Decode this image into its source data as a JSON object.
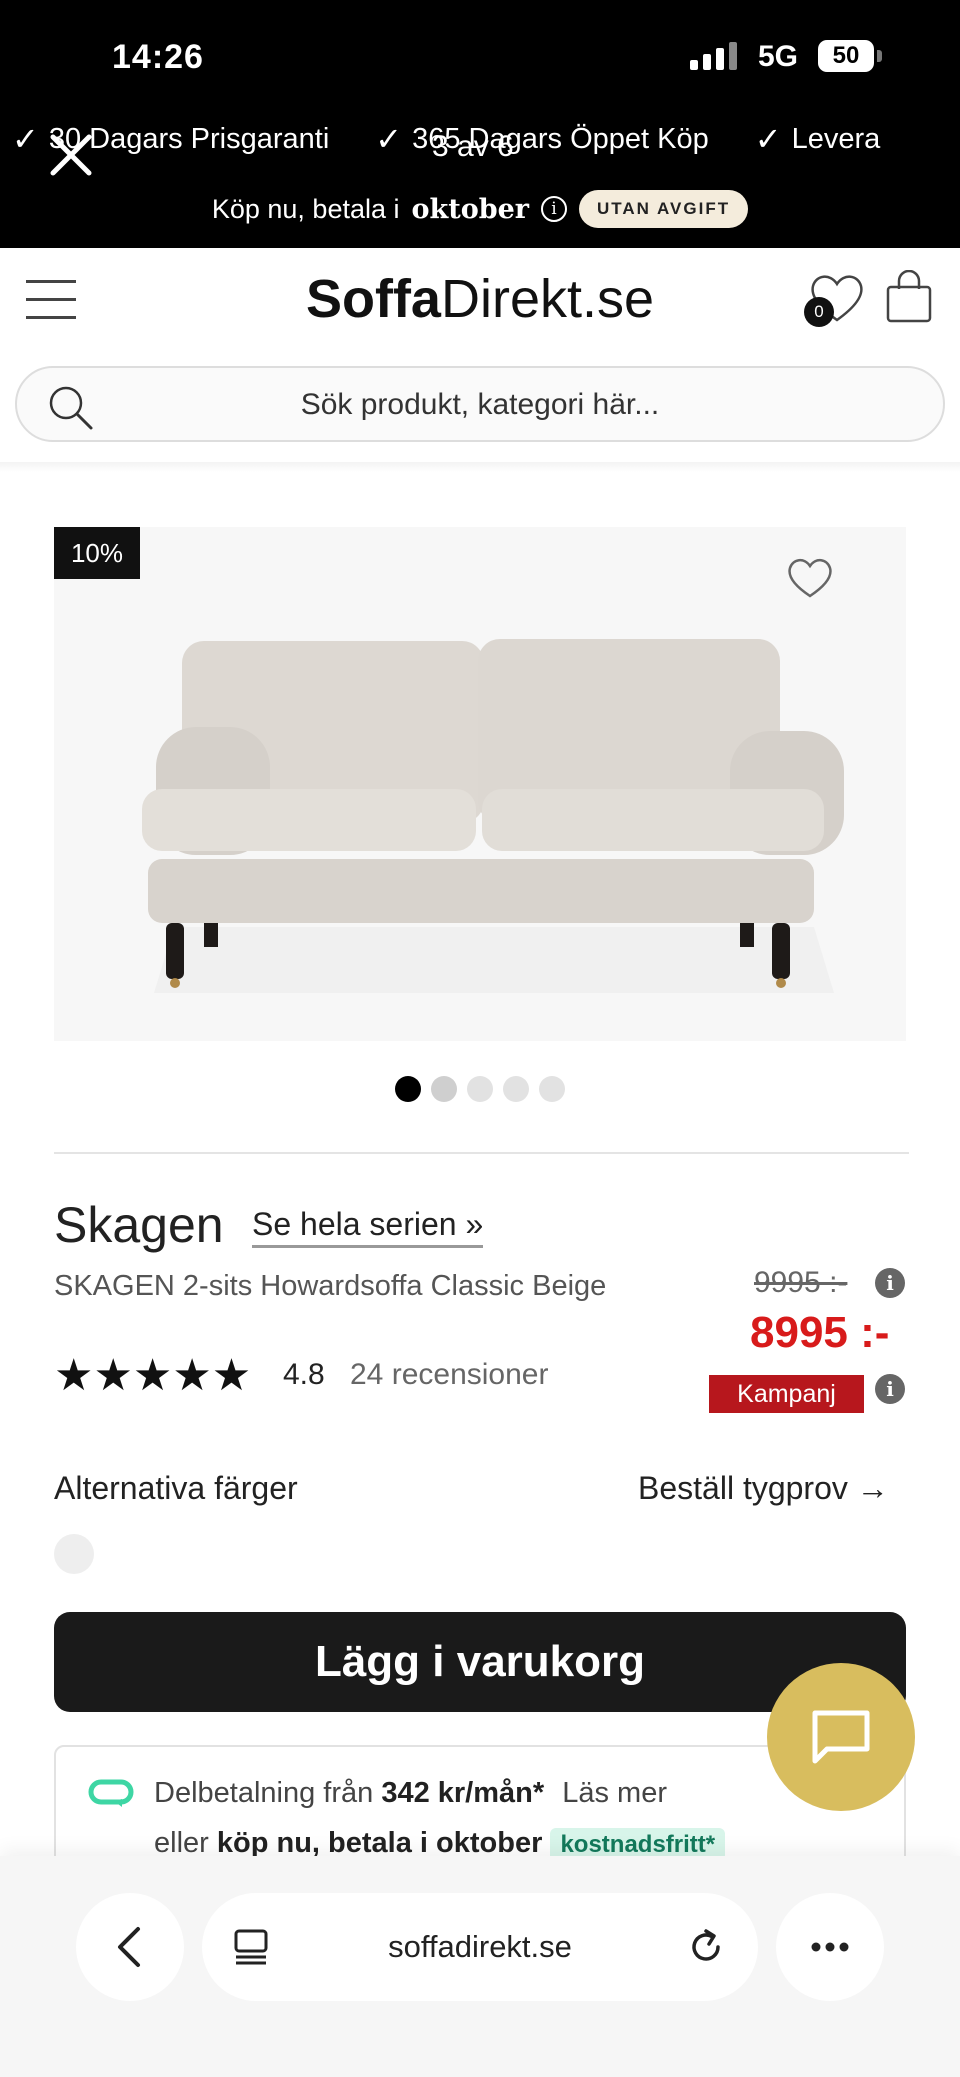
{
  "status": {
    "time": "14:26",
    "network": "5G",
    "battery": "50"
  },
  "banner": {
    "usps": [
      "30 Dagars Prisgaranti",
      "365 Dagars Öppet Köp",
      "Levera"
    ],
    "gallery_counter": "3 av 6",
    "paylater_text": "Köp nu, betala i",
    "paylater_brand": "oktober",
    "paylater_badge": "UTAN AVGIFT"
  },
  "header": {
    "logo_bold": "Soffa",
    "logo_rest": "Direkt.se",
    "wishlist_count": "0"
  },
  "search": {
    "placeholder": "Sök produkt, kategori här..."
  },
  "product": {
    "discount_badge": "10%",
    "gallery_dots": 5,
    "gallery_active": 0,
    "series": "Skagen",
    "series_link": "Se hela serien »",
    "name": "SKAGEN 2-sits Howardsoffa Classic Beige",
    "old_price": "9995 :-",
    "price": "8995 :-",
    "campaign": "Kampanj",
    "stars": "★★★★★",
    "rating": "4.8",
    "reviews": "24 recensioner",
    "alt_colors": "Alternativa färger",
    "order_sample": "Beställ tygprov →",
    "add_to_cart": "Lägg i varukorg"
  },
  "installment": {
    "line1_pre": "Delbetalning från",
    "line1_amount": "342 kr/mån*",
    "line1_link": "Läs mer",
    "line2_pre": "eller",
    "line2_bold": "köp nu, betala i oktober",
    "line2_badge": "kostnadsfritt*"
  },
  "browser": {
    "url": "soffadirekt.se"
  },
  "colors": {
    "price_red": "#d81b1b",
    "campaign_red": "#b7171d",
    "chat_gold": "#d8bd5e"
  }
}
